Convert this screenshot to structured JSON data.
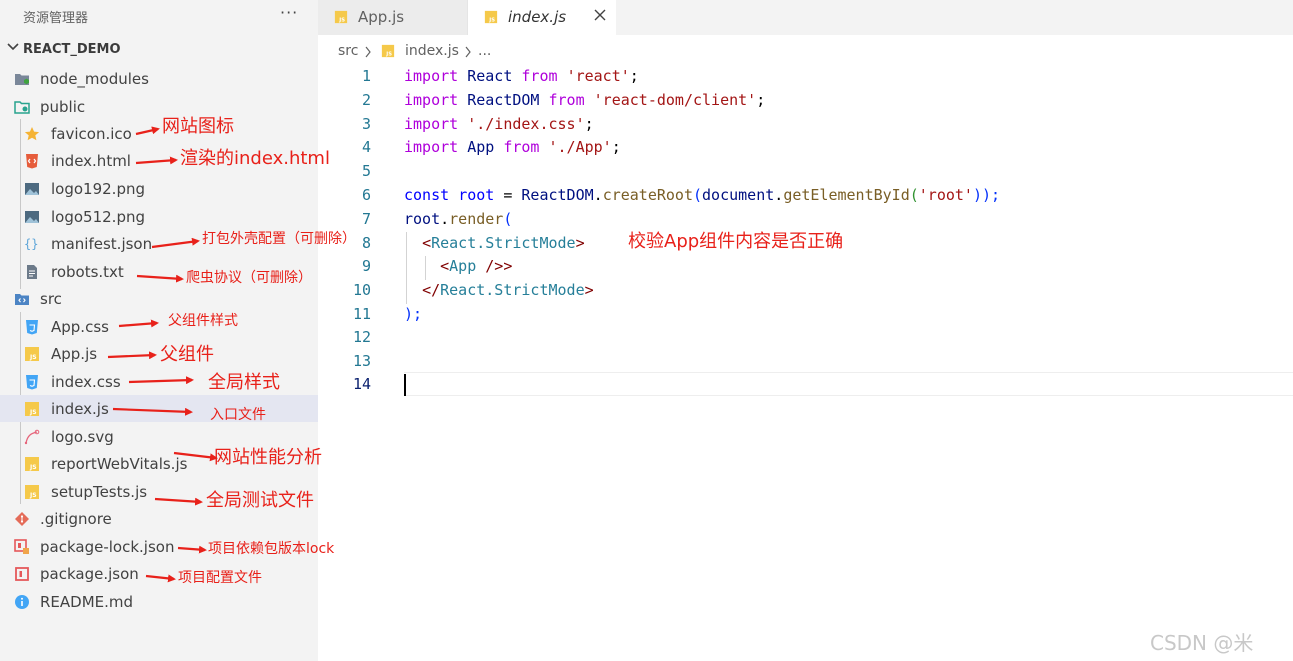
{
  "explorer": {
    "title": "资源管理器",
    "more": "···",
    "root_label": "REACT_DEMO",
    "items": [
      {
        "label": "node_modules",
        "annotation": ""
      },
      {
        "label": "public",
        "annotation": ""
      },
      {
        "label": "favicon.ico",
        "annotation": "网站图标"
      },
      {
        "label": "index.html",
        "annotation": "渲染的index.html"
      },
      {
        "label": "logo192.png",
        "annotation": ""
      },
      {
        "label": "logo512.png",
        "annotation": ""
      },
      {
        "label": "manifest.json",
        "annotation": "打包外壳配置（可删除）"
      },
      {
        "label": "robots.txt",
        "annotation": "爬虫协议（可删除）"
      },
      {
        "label": "src",
        "annotation": ""
      },
      {
        "label": "App.css",
        "annotation": "父组件样式"
      },
      {
        "label": "App.js",
        "annotation": "父组件"
      },
      {
        "label": "index.css",
        "annotation": "全局样式"
      },
      {
        "label": "index.js",
        "annotation": "入口文件"
      },
      {
        "label": "logo.svg",
        "annotation": ""
      },
      {
        "label": "reportWebVitals.js",
        "annotation": "网站性能分析"
      },
      {
        "label": "setupTests.js",
        "annotation": "全局测试文件"
      },
      {
        "label": ".gitignore",
        "annotation": ""
      },
      {
        "label": "package-lock.json",
        "annotation": "项目依赖包版本lock"
      },
      {
        "label": "package.json",
        "annotation": "项目配置文件"
      },
      {
        "label": "README.md",
        "annotation": ""
      }
    ]
  },
  "tabs": [
    {
      "label": "App.js"
    },
    {
      "label": "index.js"
    }
  ],
  "breadcrumb": {
    "segment1": "src",
    "segment2": "index.js",
    "ellipsis": "..."
  },
  "editor": {
    "line_numbers": [
      "1",
      "2",
      "3",
      "4",
      "5",
      "6",
      "7",
      "8",
      "9",
      "10",
      "11",
      "12",
      "13",
      "14"
    ],
    "code_annotation": "校验App组件内容是否正确",
    "tokens": {
      "import": "import",
      "from": "from",
      "React": "React",
      "ReactDOM": "ReactDOM",
      "App": "App",
      "s_react": "'react'",
      "s_react_dom": "'react-dom/client'",
      "s_index_css": "'./index.css'",
      "s_app": "'./App'",
      "semi": ";",
      "const": "const",
      "root": "root",
      "eq": " = ",
      "dot": ".",
      "createRoot": "createRoot",
      "lp": "(",
      "document": "document",
      "getElementById": "getElementById",
      "s_root": "'root'",
      "rp_semi": "));",
      "render": "render",
      "lt": "<",
      "ltslash": "</",
      "gt": ">",
      "selfclose": " />",
      "React_StrictMode": "React.StrictMode",
      "close_paren_semi": ");"
    }
  },
  "watermark": "CSDN @米",
  "colors": {
    "annotation": "#e8211a",
    "keyword": "#af00db",
    "string": "#a31515",
    "identifier": "#001080",
    "function": "#795e26",
    "jsx_tag": "#267f99",
    "line_number": "#237893"
  }
}
